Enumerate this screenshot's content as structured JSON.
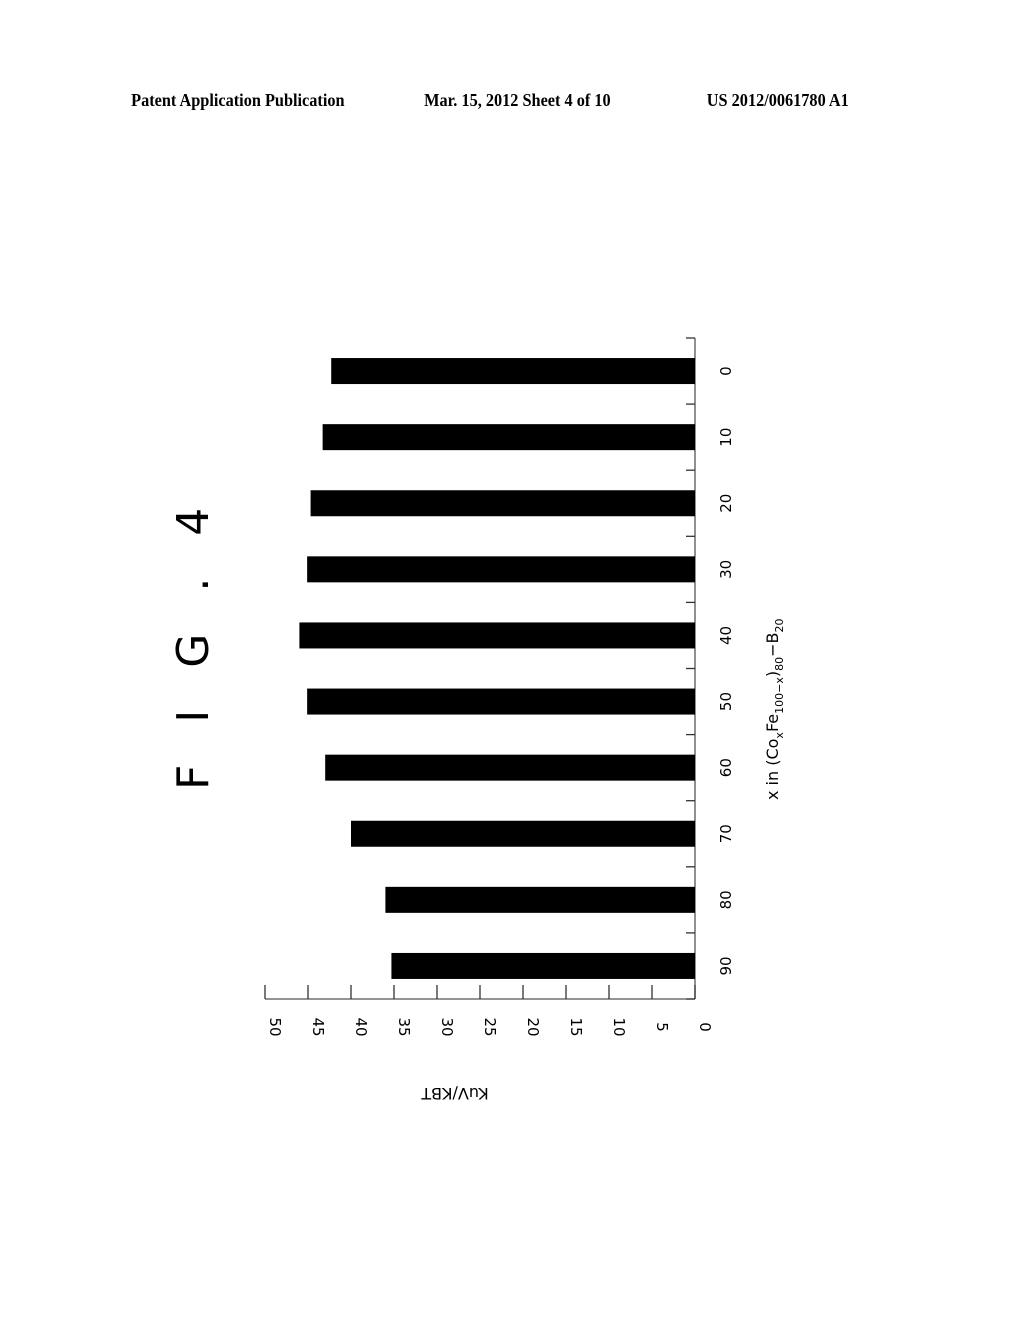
{
  "header": {
    "publication": "Patent Application Publication",
    "date_sheet": "Mar. 15, 2012  Sheet 4 of 10",
    "patent_number": "US 2012/0061780 A1"
  },
  "figure": {
    "title": "F I G . 4"
  },
  "chart_data": {
    "type": "bar",
    "orientation": "horizontal-rotated",
    "title": "F I G . 4",
    "xlabel": "x in (CoxFe100-x)80-B20",
    "xlabel_parts": {
      "prefix": "x in (Co",
      "sub1": "x",
      "mid1": "Fe",
      "sub2": "100−x",
      "mid2": ")",
      "sub3": "80",
      "mid3": "−B",
      "sub4": "20"
    },
    "ylabel": "KuV/KBT",
    "categories": [
      "0",
      "10",
      "20",
      "30",
      "40",
      "50",
      "60",
      "70",
      "80",
      "90"
    ],
    "values": [
      42.3,
      43.3,
      44.7,
      45.1,
      46.0,
      45.1,
      43.0,
      40.0,
      36.0,
      35.3
    ],
    "ylim": [
      0,
      50
    ],
    "yticks": [
      0,
      5,
      10,
      15,
      20,
      25,
      30,
      35,
      40,
      45,
      50
    ],
    "grid": false,
    "legend": "none",
    "bar_color": "#000000"
  }
}
